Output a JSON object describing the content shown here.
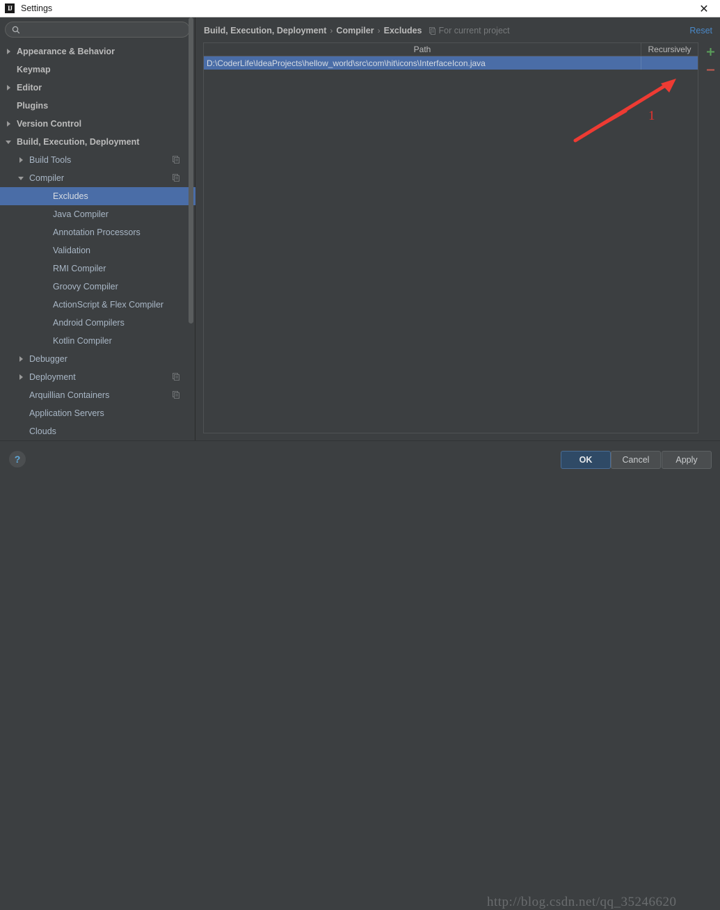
{
  "window": {
    "title": "Settings",
    "logo_text": "IJ",
    "close_label": "✕"
  },
  "sidebar": {
    "search": {
      "value": "",
      "placeholder": "",
      "icon": "search-icon"
    },
    "items": [
      {
        "label": "Appearance & Behavior",
        "level": 0,
        "arrow": "right",
        "badge": false,
        "selected": false
      },
      {
        "label": "Keymap",
        "level": 0,
        "arrow": "none",
        "badge": false,
        "selected": false
      },
      {
        "label": "Editor",
        "level": 0,
        "arrow": "right",
        "badge": false,
        "selected": false
      },
      {
        "label": "Plugins",
        "level": 0,
        "arrow": "none",
        "badge": false,
        "selected": false
      },
      {
        "label": "Version Control",
        "level": 0,
        "arrow": "right",
        "badge": false,
        "selected": false
      },
      {
        "label": "Build, Execution, Deployment",
        "level": 0,
        "arrow": "down",
        "badge": false,
        "selected": false
      },
      {
        "label": "Build Tools",
        "level": 1,
        "arrow": "right",
        "badge": true,
        "selected": false
      },
      {
        "label": "Compiler",
        "level": 1,
        "arrow": "down",
        "badge": true,
        "selected": false
      },
      {
        "label": "Excludes",
        "level": 2,
        "arrow": "none",
        "badge": false,
        "selected": true
      },
      {
        "label": "Java Compiler",
        "level": 2,
        "arrow": "none",
        "badge": false,
        "selected": false
      },
      {
        "label": "Annotation Processors",
        "level": 2,
        "arrow": "none",
        "badge": false,
        "selected": false
      },
      {
        "label": "Validation",
        "level": 2,
        "arrow": "none",
        "badge": false,
        "selected": false
      },
      {
        "label": "RMI Compiler",
        "level": 2,
        "arrow": "none",
        "badge": false,
        "selected": false
      },
      {
        "label": "Groovy Compiler",
        "level": 2,
        "arrow": "none",
        "badge": false,
        "selected": false
      },
      {
        "label": "ActionScript & Flex Compiler",
        "level": 2,
        "arrow": "none",
        "badge": false,
        "selected": false
      },
      {
        "label": "Android Compilers",
        "level": 2,
        "arrow": "none",
        "badge": false,
        "selected": false
      },
      {
        "label": "Kotlin Compiler",
        "level": 2,
        "arrow": "none",
        "badge": false,
        "selected": false
      },
      {
        "label": "Debugger",
        "level": 1,
        "arrow": "right",
        "badge": false,
        "selected": false
      },
      {
        "label": "Deployment",
        "level": 1,
        "arrow": "right",
        "badge": true,
        "selected": false
      },
      {
        "label": "Arquillian Containers",
        "level": 1,
        "arrow": "none",
        "badge": true,
        "selected": false
      },
      {
        "label": "Application Servers",
        "level": 1,
        "arrow": "none",
        "badge": false,
        "selected": false
      },
      {
        "label": "Clouds",
        "level": 1,
        "arrow": "none",
        "badge": false,
        "selected": false
      }
    ]
  },
  "main": {
    "breadcrumb": [
      "Build, Execution, Deployment",
      "Compiler",
      "Excludes"
    ],
    "breadcrumb_separator": "›",
    "scope_label": "For current project",
    "reset_label": "Reset",
    "table": {
      "columns": [
        "Path",
        "Recursively"
      ],
      "rows": [
        {
          "path": "D:\\CoderLife\\IdeaProjects\\hellow_world\\src\\com\\hit\\icons\\InterfaceIcon.java",
          "recursively": "",
          "selected": true
        }
      ]
    },
    "side_buttons": [
      {
        "name": "add-entry-button",
        "glyph": "+",
        "color": "#5a9e5a"
      },
      {
        "name": "remove-entry-button",
        "glyph": "−",
        "color": "#c05a50"
      }
    ]
  },
  "annotation": {
    "number": "1",
    "arrow_color": "#ee3b33"
  },
  "footer": {
    "help_label": "?",
    "ok_label": "OK",
    "cancel_label": "Cancel",
    "apply_label": "Apply",
    "watermark": "http://blog.csdn.net/qq_35246620"
  },
  "colors": {
    "background": "#3c3f41",
    "selection": "#4a6da7",
    "link": "#4a88c7",
    "text": "#a9b7c6",
    "accent_red": "#ee3b33"
  }
}
